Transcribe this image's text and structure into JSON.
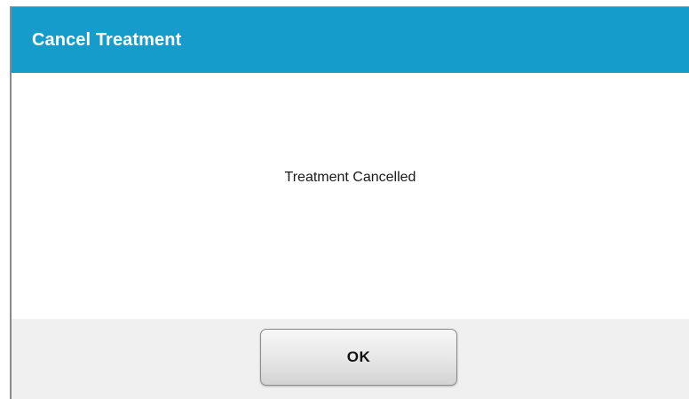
{
  "dialog": {
    "title": "Cancel Treatment",
    "message": "Treatment Cancelled",
    "ok_label": "OK"
  },
  "colors": {
    "titlebar": "#169ccb",
    "footer": "#f0f0f0"
  }
}
